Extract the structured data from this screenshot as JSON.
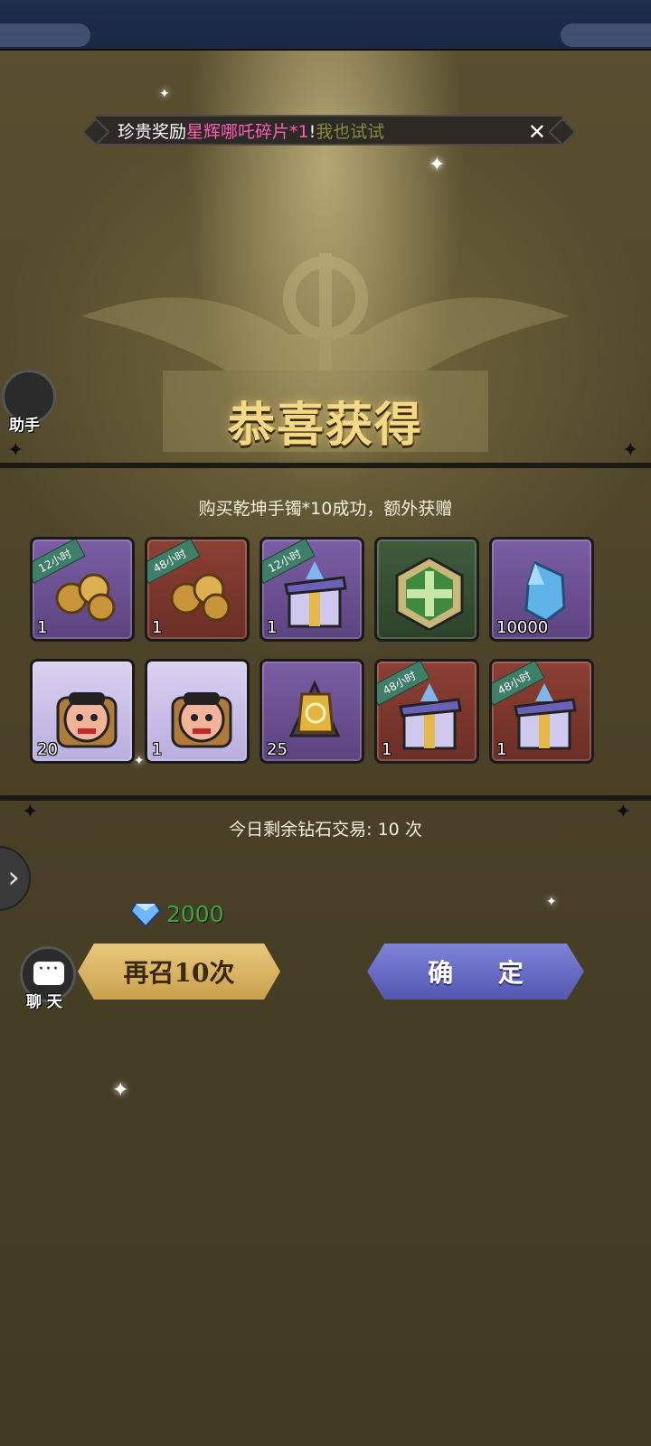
{
  "banner": {
    "prefix": "珍贵奖励",
    "item_name": "星辉哪吒碎片*1",
    "exclaim": "!",
    "cta": "我也试试",
    "close_icon": "close-icon"
  },
  "title": "恭喜获得",
  "subtitle": "购买乾坤手镯*10成功，额外获赠",
  "items": [
    {
      "icon": "gold-roses-icon",
      "quality": "purple",
      "tag": "12小时",
      "count": "1"
    },
    {
      "icon": "gold-roses-icon",
      "quality": "red",
      "tag": "48小时",
      "count": "1"
    },
    {
      "icon": "exp-gift-box-icon",
      "quality": "purple",
      "tag": "12小时",
      "count": "1"
    },
    {
      "icon": "green-emblem-icon",
      "quality": "green",
      "tag": "",
      "count": ""
    },
    {
      "icon": "blue-crystal-icon",
      "quality": "purple",
      "tag": "",
      "count": "10000"
    },
    {
      "icon": "hero-fragment-icon",
      "quality": "lilac",
      "tag": "",
      "count": "20"
    },
    {
      "icon": "hero-fragment-icon",
      "quality": "lilac",
      "tag": "",
      "count": "1"
    },
    {
      "icon": "gold-talisman-icon",
      "quality": "purple",
      "tag": "",
      "count": "25"
    },
    {
      "icon": "exp-gift-box-icon",
      "quality": "red",
      "tag": "48小时",
      "count": "1"
    },
    {
      "icon": "exp-gift-box-icon",
      "quality": "red",
      "tag": "48小时",
      "count": "1"
    }
  ],
  "remaining_trades": "今日剩余钻石交易: 10 次",
  "cost": {
    "icon": "diamond-icon",
    "value": "2000"
  },
  "buttons": {
    "summon_again": "再召10次",
    "confirm": "确 定"
  },
  "side": {
    "helper_label": "助手",
    "chat_label": "聊 天",
    "expand_icon": "chevron-right-icon"
  },
  "colors": {
    "highlight_pink": "#ff5db3",
    "cost_green": "#3ca43c",
    "gold_button": "#d8b564",
    "blue_button": "#6a6ec8"
  }
}
